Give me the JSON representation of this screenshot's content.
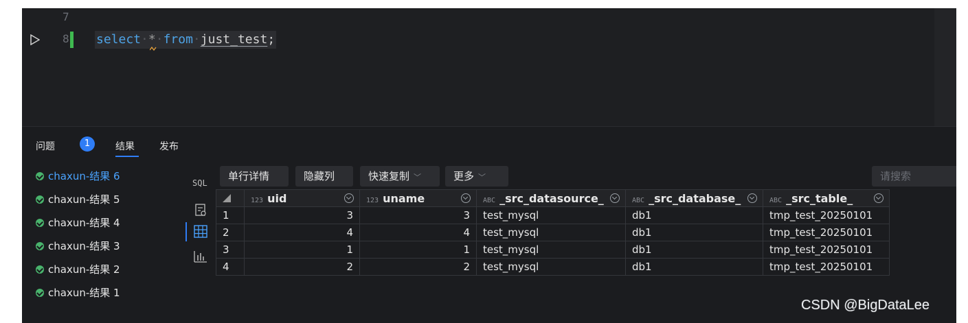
{
  "editor": {
    "line_numbers": [
      "7",
      "8"
    ],
    "code_tokens": {
      "kw1": "select",
      "star": "*",
      "kw2": "from",
      "table": "just_test",
      "end": ";"
    }
  },
  "panel_tabs": {
    "problems_label": "问题",
    "problems_count": "1",
    "results_label": "结果",
    "publish_label": "发布"
  },
  "results_list": [
    {
      "label": "chaxun-结果 6",
      "active": true
    },
    {
      "label": "chaxun-结果 5",
      "active": false
    },
    {
      "label": "chaxun-结果 4",
      "active": false
    },
    {
      "label": "chaxun-结果 3",
      "active": false
    },
    {
      "label": "chaxun-结果 2",
      "active": false
    },
    {
      "label": "chaxun-结果 1",
      "active": false
    }
  ],
  "icon_column": {
    "sql_label": "SQL",
    "icons": [
      "record-icon",
      "table-grid-icon",
      "bar-chart-icon"
    ]
  },
  "toolbar": {
    "row_detail": "单行详情",
    "hide_columns": "隐藏列",
    "quick_copy": "快速复制",
    "more": "更多",
    "search_placeholder": "请搜索"
  },
  "table": {
    "columns": [
      {
        "type": "123",
        "name": "uid"
      },
      {
        "type": "123",
        "name": "uname"
      },
      {
        "type": "ABC",
        "name": "_src_datasource_"
      },
      {
        "type": "ABC",
        "name": "_src_database_"
      },
      {
        "type": "ABC",
        "name": "_src_table_"
      }
    ],
    "rows": [
      {
        "idx": "1",
        "uid": "3",
        "uname": "3",
        "ds": "test_mysql",
        "db": "db1",
        "tb": "tmp_test_20250101"
      },
      {
        "idx": "2",
        "uid": "4",
        "uname": "4",
        "ds": "test_mysql",
        "db": "db1",
        "tb": "tmp_test_20250101"
      },
      {
        "idx": "3",
        "uid": "1",
        "uname": "1",
        "ds": "test_mysql",
        "db": "db1",
        "tb": "tmp_test_20250101"
      },
      {
        "idx": "4",
        "uid": "2",
        "uname": "2",
        "ds": "test_mysql",
        "db": "db1",
        "tb": "tmp_test_20250101"
      }
    ]
  },
  "watermark": "CSDN @BigDataLee",
  "colors": {
    "accent": "#2f7df6",
    "success": "#49b36c",
    "keyword": "#4ea3e6",
    "background": "#1e1f22"
  }
}
